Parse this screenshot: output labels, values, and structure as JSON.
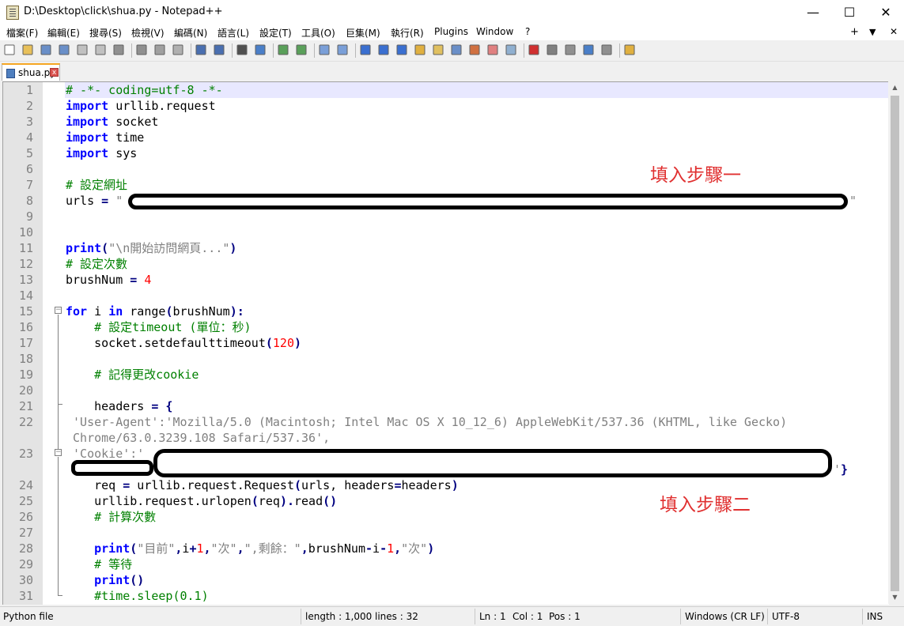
{
  "window": {
    "title": "D:\\Desktop\\click\\shua.py - Notepad++",
    "minimize_glyph": "—",
    "maximize_glyph": "☐",
    "close_glyph": "✕"
  },
  "menu": {
    "items": [
      "檔案(F)",
      "編輯(E)",
      "搜尋(S)",
      "檢視(V)",
      "編碼(N)",
      "語言(L)",
      "設定(T)",
      "工具(O)",
      "巨集(M)",
      "執行(R)",
      "Plugins",
      "Window",
      "?"
    ],
    "right_plus": "+",
    "right_down": "▼",
    "right_close": "✕"
  },
  "toolbar": {
    "icons": [
      "new-file-icon",
      "open-file-icon",
      "save-icon",
      "save-all-icon",
      "close-icon",
      "close-all-icon",
      "print-icon",
      "cut-icon",
      "copy-icon",
      "paste-icon",
      "undo-icon",
      "redo-icon",
      "find-icon",
      "replace-icon",
      "zoom-in-icon",
      "zoom-out-icon",
      "sync-vertical-icon",
      "sync-horizontal-icon",
      "word-wrap-icon",
      "show-all-chars-icon",
      "indent-guide-icon",
      "user-defined-lang-icon",
      "doc-map-icon",
      "function-list-icon",
      "folder-workspace-icon",
      "doc-switcher-icon",
      "monitoring-icon",
      "record-macro-icon",
      "stop-record-icon",
      "play-macro-icon",
      "run-macro-multiple-icon",
      "save-macro-icon",
      "launch-icon"
    ]
  },
  "tab": {
    "label": "shua.py",
    "close_glyph": "x"
  },
  "editor": {
    "line_numbers": [
      "1",
      "2",
      "3",
      "4",
      "5",
      "6",
      "7",
      "8",
      "9",
      "10",
      "11",
      "12",
      "13",
      "14",
      "15",
      "16",
      "17",
      "18",
      "19",
      "20",
      "21",
      "22",
      "",
      "23",
      "",
      "24",
      "25",
      "26",
      "27",
      "28",
      "29",
      "30",
      "31"
    ],
    "code": {
      "l1": "# -*- coding=utf-8 -*-",
      "l2_kw": "import",
      "l2_rest": " urllib.request",
      "l3_kw": "import",
      "l3_rest": " socket",
      "l4_kw": "import",
      "l4_rest": " time",
      "l5_kw": "import",
      "l5_rest": " sys",
      "l7": "# 設定網址",
      "l8_a": "urls ",
      "l8_op": "=",
      "l8_b": " \"",
      "l8_end": "\"",
      "l11_kw": "print",
      "l11_op1": "(",
      "l11_str": "\"\\n開始訪問網頁...\"",
      "l11_op2": ")",
      "l12": "# 設定次數",
      "l13_a": "brushNum ",
      "l13_op": "=",
      "l13_num": " 4",
      "l15_kw1": "for",
      "l15_a": " i ",
      "l15_kw2": "in",
      "l15_b": " range",
      "l15_op1": "(",
      "l15_c": "brushNum",
      "l15_op2": "):",
      "l16": "    # 設定timeout (單位：秒)",
      "l17_a": "    socket.setdefaulttimeout",
      "l17_op1": "(",
      "l17_num": "120",
      "l17_op2": ")",
      "l19": "    # 記得更改cookie",
      "l21_a": "    headers ",
      "l21_op": "= {",
      "l22a": " 'User-Agent':'Mozilla/5.0 (Macintosh; Intel Mac OS X 10_12_6) AppleWebKit/537.36 (KHTML, like Gecko)",
      "l22b": " Chrome/63.0.3239.108 Safari/537.36',",
      "l23a": " 'Cookie':'",
      "l23b_end": "'}",
      "l24_a": "    req ",
      "l24_op1": "=",
      "l24_b": " urllib.request.Request",
      "l24_op2": "(",
      "l24_c": "urls, headers",
      "l24_op3": "=",
      "l24_d": "headers",
      "l24_op4": ")",
      "l25_a": "    urllib.request.urlopen",
      "l25_op1": "(",
      "l25_b": "req",
      "l25_op2": ").",
      "l25_c": "read",
      "l25_op3": "()",
      "l26": "    # 計算次數",
      "l28_kw": "    print",
      "l28_op1": "(",
      "l28_s1": "\"目前\"",
      "l28_op2": ",",
      "l28_a": "i",
      "l28_op3": "+",
      "l28_n1": "1",
      "l28_op4": ",",
      "l28_s2": "\"次\"",
      "l28_op5": ",",
      "l28_s3": "\",剩餘：\"",
      "l28_op6": ",",
      "l28_b": "brushNum",
      "l28_op7": "-",
      "l28_c": "i",
      "l28_op8": "-",
      "l28_n2": "1",
      "l28_op9": ",",
      "l28_s4": "\"次\"",
      "l28_op10": ")",
      "l29": "    # 等待",
      "l30_kw": "    print",
      "l30_op": "()",
      "l31": "    #time.sleep(0.1)"
    },
    "annotations": {
      "step1": "填入步驟一",
      "step2": "填入步驟二"
    }
  },
  "statusbar": {
    "lang": "Python file",
    "length": "length : 1,000",
    "lines": "lines : 32",
    "ln": "Ln : 1",
    "col": "Col : 1",
    "pos": "Pos : 1",
    "eol": "Windows (CR LF)",
    "encoding": "UTF-8",
    "mode": "INS"
  }
}
